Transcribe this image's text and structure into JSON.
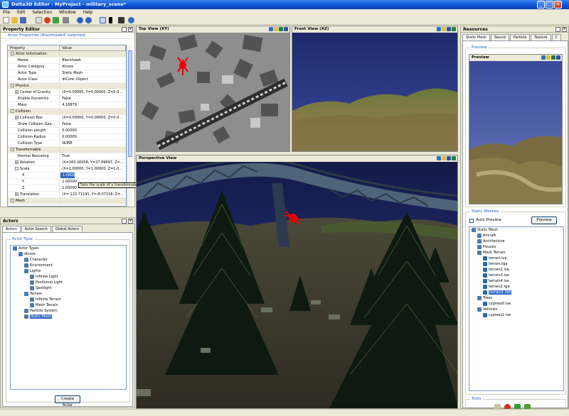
{
  "window": {
    "title": "Delta3D Editor - MyProject - military_scene*",
    "min": "_",
    "max": "□",
    "close": "×"
  },
  "menu": [
    "File",
    "Edit",
    "Selection",
    "Window",
    "Help"
  ],
  "toolbar": {
    "icons": [
      "new-icon",
      "open-icon",
      "save-icon",
      "undo-icon",
      "redo-icon",
      "select-icon",
      "move-icon",
      "rotate-icon"
    ]
  },
  "property_editor": {
    "title": "Property Editor",
    "subtitle": "Actor Properties (Blackhawk4' selected)",
    "col_property": "Property",
    "col_value": "Value",
    "rows": [
      {
        "name": "Actor Information",
        "value": "",
        "level": 0,
        "cat": true,
        "exp": "-"
      },
      {
        "name": "Name",
        "value": "Blackhawk",
        "level": 2
      },
      {
        "name": "Actor Category",
        "value": "dtcore",
        "level": 2
      },
      {
        "name": "Actor Type",
        "value": "Static Mesh",
        "level": 2
      },
      {
        "name": "Actor Class",
        "value": "dtCore::Object",
        "level": 2
      },
      {
        "name": "Physics",
        "value": "",
        "level": 0,
        "cat": true,
        "exp": "-"
      },
      {
        "name": "Center of Gravity",
        "value": "(X=0.00000, Y=0.00000, Z=0.0...",
        "level": 1,
        "exp": "+"
      },
      {
        "name": "Enable Dynamics",
        "value": "False",
        "level": 2
      },
      {
        "name": "Mass",
        "value": "4.18879",
        "level": 2
      },
      {
        "name": "Collision",
        "value": "",
        "level": 0,
        "cat": true,
        "exp": "-"
      },
      {
        "name": "Collision Box",
        "value": "(X=0.00000, Y=0.00000, Z=0.0...",
        "level": 1,
        "exp": "+"
      },
      {
        "name": "Show Collision Geo...",
        "value": "False",
        "level": 2
      },
      {
        "name": "Collision Length",
        "value": "0.00000",
        "level": 2
      },
      {
        "name": "Collision Radius",
        "value": "0.00000",
        "level": 2
      },
      {
        "name": "Collision Type",
        "value": "NONE",
        "level": 2
      },
      {
        "name": "Transformable",
        "value": "",
        "level": 0,
        "cat": true,
        "exp": "-"
      },
      {
        "name": "Normal Rescaling",
        "value": "True",
        "level": 2
      },
      {
        "name": "Rotation",
        "value": "(X=343.16058, Y=27.89697, Z=...",
        "level": 1,
        "exp": "+"
      },
      {
        "name": "Scale",
        "value": "(X=1.00000, Y=1.00000, Z=1.0...",
        "level": 1,
        "exp": "-"
      },
      {
        "name": "X",
        "value": "1.0000",
        "level": 3,
        "edit": true
      },
      {
        "name": "Y",
        "value": "1.00000",
        "level": 3
      },
      {
        "name": "Z",
        "value": "1.00000",
        "level": 3
      },
      {
        "name": "Translation",
        "value": "(X=-123.71191, Y=-8.07158, Z=...",
        "level": 1,
        "exp": "+"
      },
      {
        "name": "Mesh",
        "value": "",
        "level": 0,
        "cat": true,
        "exp": "-"
      }
    ],
    "tooltip": "Sets the scale of a transformable. (Type: X"
  },
  "actors": {
    "title": "Actors",
    "tabs": [
      "Actors",
      "Actor Search",
      "Global Actors"
    ],
    "group": "Actor Type",
    "tree": [
      {
        "label": "Actor Types",
        "level": 0,
        "icon": "folder"
      },
      {
        "label": "dtcore",
        "level": 1,
        "icon": "folder"
      },
      {
        "label": "Character",
        "level": 2,
        "icon": "actor"
      },
      {
        "label": "Environment",
        "level": 2,
        "icon": "folder"
      },
      {
        "label": "Lights",
        "level": 2,
        "icon": "folder"
      },
      {
        "label": "Infinite Light",
        "level": 3,
        "icon": "actor"
      },
      {
        "label": "Positional Light",
        "level": 3,
        "icon": "actor"
      },
      {
        "label": "Spotlight",
        "level": 3,
        "icon": "actor"
      },
      {
        "label": "Terrain",
        "level": 2,
        "icon": "folder"
      },
      {
        "label": "Infinite Terrain",
        "level": 3,
        "icon": "actor"
      },
      {
        "label": "Mesh Terrain",
        "level": 3,
        "icon": "actor"
      },
      {
        "label": "Particle System",
        "level": 2,
        "icon": "actor"
      },
      {
        "label": "Static Mesh",
        "level": 2,
        "icon": "actor",
        "selected": true
      }
    ],
    "create_button": "Create Actor"
  },
  "views": {
    "top": "Top View (XY)",
    "front": "Front View (XZ)",
    "perspective": "Perspective View"
  },
  "resources": {
    "title": "Resources",
    "tabs": [
      "Static Mesh",
      "Sound",
      "Particle",
      "Texture",
      "C"
    ],
    "preview_group": "Preview",
    "preview_title": "Preview",
    "static_meshes_group": "Static Meshes",
    "auto_preview": "Auto Preview",
    "preview_button": "Preview",
    "tree": [
      {
        "label": "Static Mesh",
        "level": 0,
        "icon": "folder"
      },
      {
        "label": "Aircraft",
        "level": 1,
        "icon": "folder"
      },
      {
        "label": "Architecture",
        "level": 1,
        "icon": "folder"
      },
      {
        "label": "Houses",
        "level": 1,
        "icon": "folder"
      },
      {
        "label": "Mesh Terrain",
        "level": 1,
        "icon": "folder"
      },
      {
        "label": "terrain.ive",
        "level": 2,
        "icon": "file"
      },
      {
        "label": "terrain.tga",
        "level": 2,
        "icon": "file"
      },
      {
        "label": "terrain2.ive",
        "level": 2,
        "icon": "file"
      },
      {
        "label": "terrain3.ive",
        "level": 2,
        "icon": "file"
      },
      {
        "label": "terrain4.ive",
        "level": 2,
        "icon": "file"
      },
      {
        "label": "terrain2.tga",
        "level": 2,
        "icon": "file"
      },
      {
        "label": "terrain2.3ds",
        "level": 2,
        "icon": "file",
        "selected": true
      },
      {
        "label": "Trees",
        "level": 1,
        "icon": "folder"
      },
      {
        "label": "cypress0.ive",
        "level": 2,
        "icon": "file"
      },
      {
        "label": "Vehicles",
        "level": 1,
        "icon": "folder"
      },
      {
        "label": "cypress1.ive",
        "level": 2,
        "icon": "file"
      }
    ],
    "tools_group": "Tools"
  }
}
